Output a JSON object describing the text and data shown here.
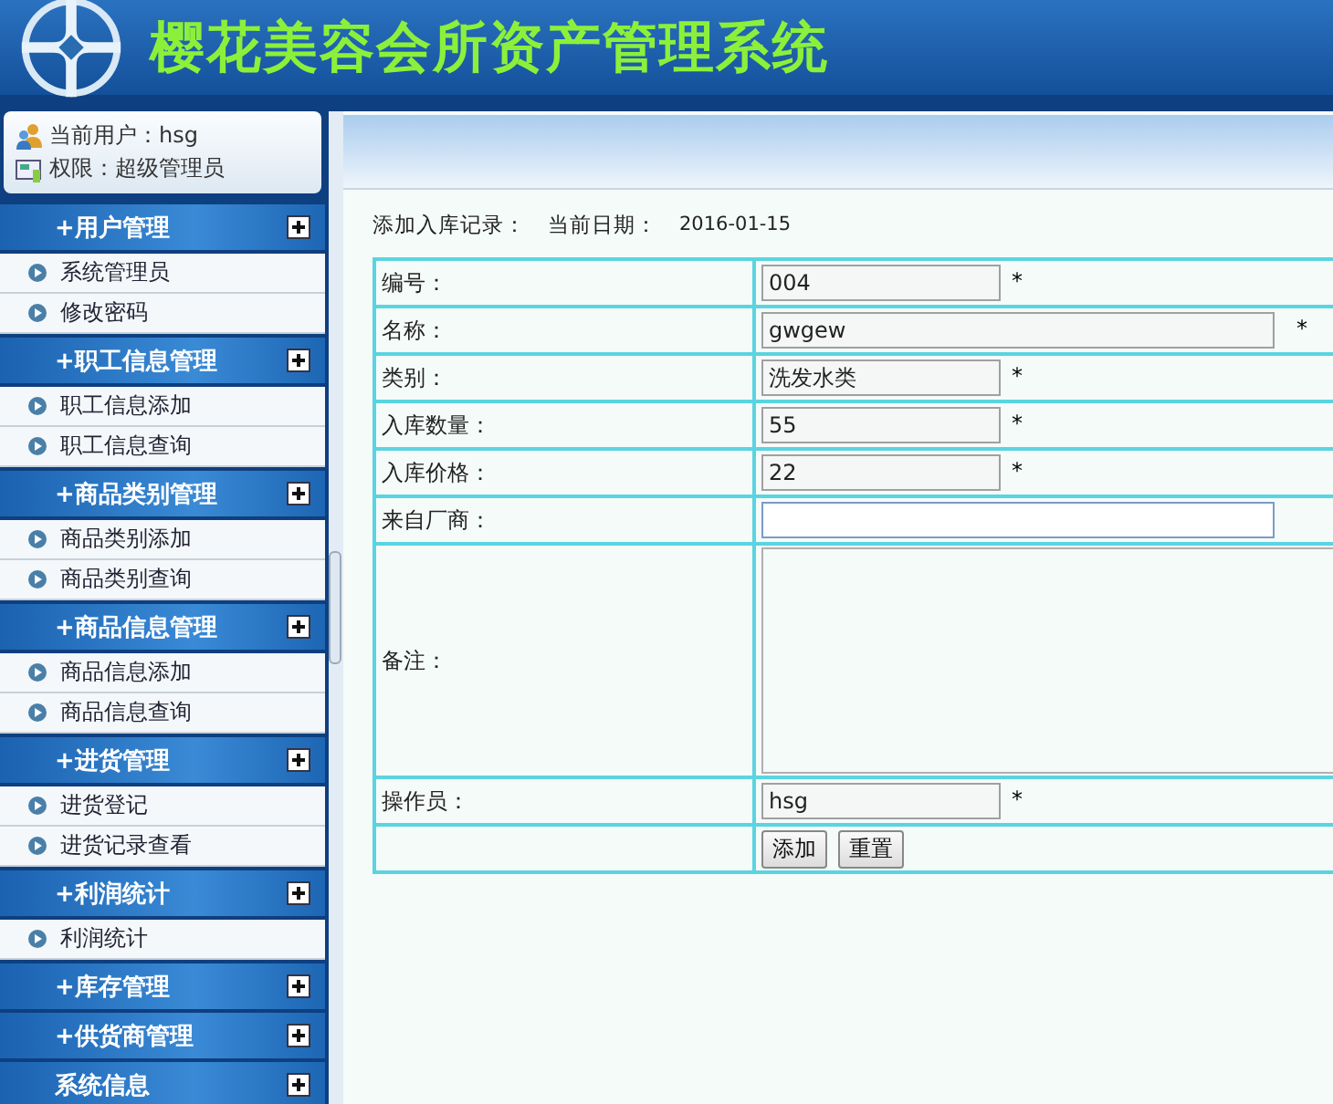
{
  "header": {
    "title": "樱花美容会所资产管理系统"
  },
  "user_panel": {
    "current_user": "当前用户：hsg",
    "permission": "权限：超级管理员"
  },
  "menu": [
    {
      "label": "+用户管理",
      "items": [
        {
          "label": "系统管理员"
        },
        {
          "label": "修改密码"
        }
      ]
    },
    {
      "label": "+职工信息管理",
      "items": [
        {
          "label": "职工信息添加"
        },
        {
          "label": "职工信息查询"
        }
      ]
    },
    {
      "label": "+商品类别管理",
      "items": [
        {
          "label": "商品类别添加"
        },
        {
          "label": "商品类别查询"
        }
      ]
    },
    {
      "label": "+商品信息管理",
      "items": [
        {
          "label": "商品信息添加"
        },
        {
          "label": "商品信息查询"
        }
      ]
    },
    {
      "label": "+进货管理",
      "items": [
        {
          "label": "进货登记"
        },
        {
          "label": "进货记录查看"
        }
      ]
    },
    {
      "label": "+利润统计",
      "items": [
        {
          "label": "利润统计"
        }
      ]
    },
    {
      "label": "+库存管理"
    },
    {
      "label": "+供货商管理"
    },
    {
      "label": "系统信息"
    }
  ],
  "form": {
    "heading": "添加入库记录：",
    "date_label": "当前日期：",
    "date": "2016-01-15",
    "rows": [
      {
        "kind": "short",
        "label": "编号：",
        "value": "004",
        "required": "*"
      },
      {
        "kind": "long",
        "label": "名称：",
        "value": "gwgew",
        "required": "*"
      },
      {
        "kind": "short",
        "label": "类别：",
        "value": "洗发水类",
        "required": "*"
      },
      {
        "kind": "short",
        "label": "入库数量：",
        "value": "55",
        "required": "*"
      },
      {
        "kind": "short",
        "label": "入库价格：",
        "value": "22",
        "required": "*"
      },
      {
        "kind": "long",
        "label": "来自厂商：",
        "value": ""
      },
      {
        "kind": "textarea",
        "label": "备注：",
        "value": ""
      },
      {
        "kind": "short",
        "label": "操作员：",
        "value": "hsg",
        "required": "*"
      }
    ],
    "buttons": [
      "添加",
      "重置"
    ]
  }
}
